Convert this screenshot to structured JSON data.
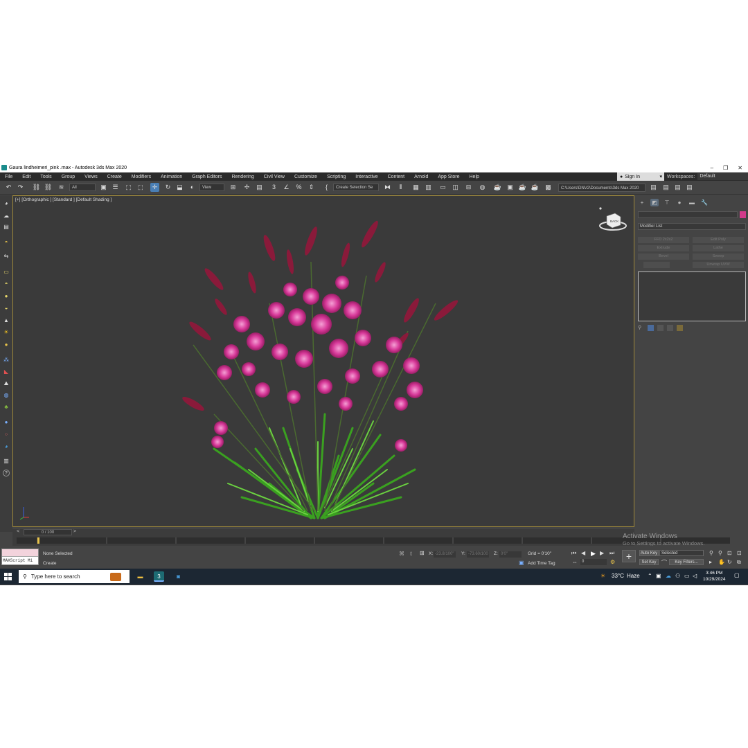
{
  "window": {
    "title": "Gaura lindheimeri_pink .max - Autodesk 3ds Max 2020",
    "minimize": "–",
    "maximize": "❐",
    "close": "✕"
  },
  "menu": [
    "File",
    "Edit",
    "Tools",
    "Group",
    "Views",
    "Create",
    "Modifiers",
    "Animation",
    "Graph Editors",
    "Rendering",
    "Civil View",
    "Customize",
    "Scripting",
    "Interactive",
    "Content",
    "Arnold",
    "App Store",
    "Help"
  ],
  "account": {
    "sign_in": "Sign In",
    "workspaces_label": "Workspaces:",
    "workspace": "Default"
  },
  "toolbar": {
    "selection_filter": "All",
    "ref_coord": "View",
    "named_selection": "Create Selection Se",
    "project_path": "C:\\Users\\DNV2\\Documents\\3ds Max 2020"
  },
  "viewport": {
    "label": "[+] [Orthographic ] [Standard ] [Default Shading ]",
    "viewcube_face": "BACK"
  },
  "command_panel": {
    "modifier_list": "Modifier List",
    "buttons": [
      "FFD 2x2x2",
      "Edit Poly",
      "Extrude",
      "Lathe",
      "Bevel",
      "Sweep",
      "",
      "Unwrap UVW"
    ]
  },
  "timeline": {
    "frame_counter": "0 / 100",
    "prev": "<",
    "next": ">"
  },
  "status": {
    "maxscript_label": "MAXScript Mi",
    "selection": "None Selected",
    "prompt": "Create",
    "x_label": "X:",
    "x_value": "-23.8/100\"",
    "y_label": "Y:",
    "y_value": "-73.60/100",
    "z_label": "Z:",
    "z_value": "0'0\"",
    "grid": "Grid = 0'10\"",
    "add_time_tag": "Add Time Tag",
    "auto_key": "Auto Key",
    "set_key": "Set Key",
    "key_mode": "Selected",
    "key_filters": "Key Filters...",
    "frame_field": "0"
  },
  "watermark": {
    "title": "Activate Windows",
    "subtitle": "Go to Settings to activate Windows."
  },
  "taskbar": {
    "search_placeholder": "Type here to search",
    "weather_temp": "33°C",
    "weather_desc": "Haze",
    "time": "3:46 PM",
    "date": "10/29/2024"
  }
}
